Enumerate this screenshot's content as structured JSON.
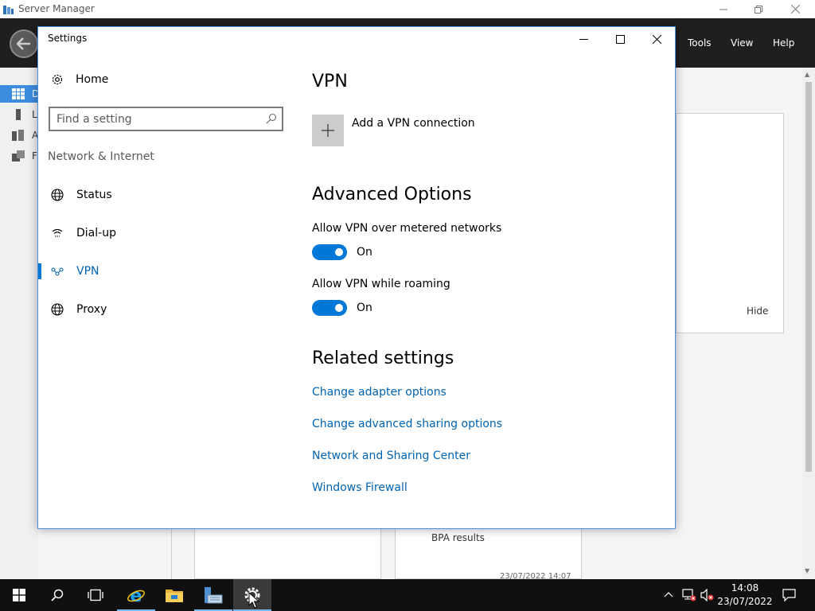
{
  "server_manager": {
    "title": "Server Manager",
    "menu": [
      "Tools",
      "View",
      "Help"
    ],
    "nav_letters": [
      "D",
      "L",
      "A",
      "F"
    ],
    "hide_label": "Hide",
    "bpa_label": "BPA results",
    "timestamp": "23/07/2022 14:07"
  },
  "settings": {
    "window_title": "Settings",
    "home_label": "Home",
    "search_placeholder": "Find a setting",
    "section_label": "Network & Internet",
    "nav_items": [
      {
        "label": "Status",
        "icon": "globe-icon"
      },
      {
        "label": "Dial-up",
        "icon": "dialup-icon"
      },
      {
        "label": "VPN",
        "icon": "vpn-icon",
        "active": true
      },
      {
        "label": "Proxy",
        "icon": "globe-icon"
      }
    ],
    "page_title": "VPN",
    "add_vpn_label": "Add a VPN connection",
    "advanced_heading": "Advanced Options",
    "options": [
      {
        "label": "Allow VPN over metered networks",
        "state": "On"
      },
      {
        "label": "Allow VPN while roaming",
        "state": "On"
      }
    ],
    "related_heading": "Related settings",
    "related_links": [
      "Change adapter options",
      "Change advanced sharing options",
      "Network and Sharing Center",
      "Windows Firewall"
    ]
  },
  "taskbar": {
    "time": "14:08",
    "date": "23/07/2022",
    "accent": "#76b9ed"
  },
  "colors": {
    "accent": "#0078d7",
    "link": "#0063b1"
  }
}
